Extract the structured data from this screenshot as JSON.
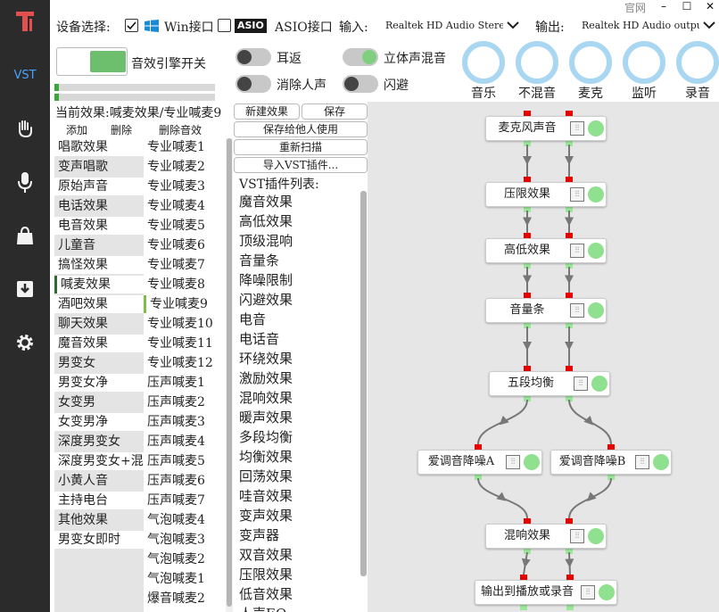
{
  "window": {
    "official_site": "官网",
    "minimize": "–",
    "maximize": "☐",
    "close": "✕"
  },
  "sidebar": {
    "items": [
      {
        "name": "logo-icon",
        "glyph": "T"
      },
      {
        "name": "vst-tab",
        "glyph": "VST"
      },
      {
        "name": "hand-wave-icon",
        "glyph": "✋"
      },
      {
        "name": "microphone-icon",
        "glyph": "🎤"
      },
      {
        "name": "shopping-bag-icon",
        "glyph": "🛍"
      },
      {
        "name": "download-icon",
        "glyph": "⬇"
      },
      {
        "name": "gear-icon",
        "glyph": "⚙"
      }
    ]
  },
  "device": {
    "label": "设备选择:",
    "win_label": "Win接口",
    "asio_badge": "ASIO",
    "asio_label": "ASIO接口",
    "input_label": "输入:",
    "input_value": "Realtek HD Audio Stere...",
    "output_label": "输出:",
    "output_value": "Realtek HD Audio output"
  },
  "toggles": {
    "engine": "音效引擎开关",
    "ear_return": "耳返",
    "stereo_mix": "立体声混音",
    "vocal_remove": "消除人声",
    "dodge": "闪避"
  },
  "knobs": [
    {
      "label": "音乐"
    },
    {
      "label": "不混音"
    },
    {
      "label": "麦克"
    },
    {
      "label": "监听"
    },
    {
      "label": "录音"
    }
  ],
  "current_effect": "当前效果:喊麦效果/专业喊麦9",
  "effect_actions": {
    "add": "添加",
    "delete": "删除",
    "delete_sound": "删除音效"
  },
  "categories": [
    "唱歌效果",
    "变声唱歌",
    "原始声音",
    "电话效果",
    "电音效果",
    "儿童音",
    "搞怪效果",
    "喊麦效果",
    "酒吧效果",
    "聊天效果",
    "魔音效果",
    "男变女",
    "男变女净",
    "女变男",
    "女变男净",
    "深度男变女",
    "深度男变女+混响",
    "小黄人音",
    "主持电台",
    "其他效果",
    "男变女即时"
  ],
  "presets": [
    "专业喊麦1",
    "专业喊麦2",
    "专业喊麦3",
    "专业喊麦4",
    "专业喊麦5",
    "专业喊麦6",
    "专业喊麦7",
    "专业喊麦8",
    "专业喊麦9",
    "专业喊麦10",
    "专业喊麦11",
    "专业喊麦12",
    "压声喊麦1",
    "压声喊麦2",
    "压声喊麦3",
    "压声喊麦4",
    "压声喊麦5",
    "压声喊麦6",
    "压声喊麦7",
    "气泡喊麦4",
    "气泡喊麦3",
    "气泡喊麦2",
    "气泡喊麦1",
    "爆音喊麦2"
  ],
  "buttons": {
    "new_effect": "新建效果",
    "save": "保存",
    "save_for_others": "保存给他人使用",
    "rescan": "重新扫描",
    "import_vst": "导入VST插件..."
  },
  "vst_list": {
    "title": "VST插件列表:",
    "items": [
      "魔音效果",
      "高低效果",
      "顶级混响",
      "音量条",
      "降噪限制",
      "闪避效果",
      "电音",
      "电话音",
      "环绕效果",
      "激励效果",
      "混响效果",
      "暖声效果",
      "多段均衡",
      "均衡效果",
      "回荡效果",
      "哇音效果",
      "变声效果",
      "变声器",
      "双音效果",
      "压限效果",
      "低音效果",
      "人声EQ"
    ]
  },
  "graph": {
    "nodes": [
      {
        "label": "麦克风声音",
        "eq": "⫶⫶"
      },
      {
        "label": "压限效果",
        "eq": "⫶⫶"
      },
      {
        "label": "高低效果",
        "eq": "⫶⫶"
      },
      {
        "label": "音量条",
        "eq": "⫶⫶"
      },
      {
        "label": "五段均衡",
        "eq": "⫶⫶"
      },
      {
        "label": "爱调音降噪A",
        "eq": "⫶⫶"
      },
      {
        "label": "爱调音降噪B",
        "eq": "⫶⫶"
      },
      {
        "label": "混响效果",
        "eq": "⫶⫶"
      },
      {
        "label": "输出到播放或录音",
        "eq": "⫶⫶"
      }
    ]
  },
  "colors": {
    "sidebar": "#2b2b2b",
    "accent_green": "#6dbf6d",
    "knob_blue": "#a9d6f0",
    "selected_marker": "#7bc043",
    "port_red": "#e80000",
    "port_green": "#9be89b"
  }
}
